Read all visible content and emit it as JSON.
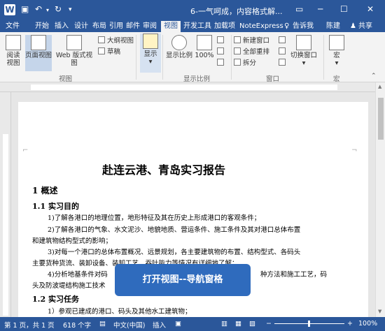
{
  "window": {
    "title": "6-一气呵成，内容格式解...",
    "doc_icon_letter": "W"
  },
  "tabs": [
    "文件",
    "开始",
    "插入",
    "设计",
    "布局",
    "引用",
    "邮件",
    "审阅",
    "视图",
    "开发工具",
    "加载项",
    "NoteExpress"
  ],
  "active_tab": "视图",
  "tell_me": "告诉我",
  "user": "陈建",
  "share": "共享",
  "ribbon": {
    "views_group": {
      "label": "视图",
      "read_mode": "阅读视图",
      "print_layout": "页面视图",
      "web_layout": "Web 版式视图",
      "outline": "大纲视图",
      "draft": "草稿"
    },
    "show": "显示",
    "zoom_group": {
      "label": "显示比例",
      "zoom": "显示比例",
      "hundred": "100%"
    },
    "window_group": {
      "label": "窗口",
      "new_window": "新建窗口",
      "arrange_all": "全部重排",
      "split": "拆分",
      "switch_windows": "切换窗口"
    },
    "macros_group": {
      "label": "宏",
      "macros": "宏"
    }
  },
  "document": {
    "title": "赴连云港、青岛实习报告",
    "h1": "1 概述",
    "h2_1": "1.1  实习目的",
    "p1": "1)了解各港口的地理位置，地形特征及其在历史上形成港口的客观条件；",
    "p2": "2)了解各港口的气象、水文泥沙、地貌地质、营运条件、施工条件及其对港口总体布置",
    "p2b": "和建筑物结构型式的影响；",
    "p3": "3)对每一个港口的总体布置概况、远景规划，各主要建筑物的布置、结构型式、各码头",
    "p3b": "主要货种货流、装卸设备、装卸工艺、吞吐能力等情况有详细地了解；",
    "p4": "4)分析地基条件对码",
    "p4tail": "种方法和施工工艺，码",
    "p4b": "头及防波堤结构施工技术",
    "h2_2": "1.2  实习任务",
    "p5": "1）参观已建成的港口、码头及其他水工建筑物；"
  },
  "overlay": "打开视图--导航窗格",
  "status": {
    "page": "第 1 页，共 1 页",
    "words": "618 个字",
    "lang": "中文(中国)",
    "insert": "插入",
    "zoom": "100%"
  }
}
